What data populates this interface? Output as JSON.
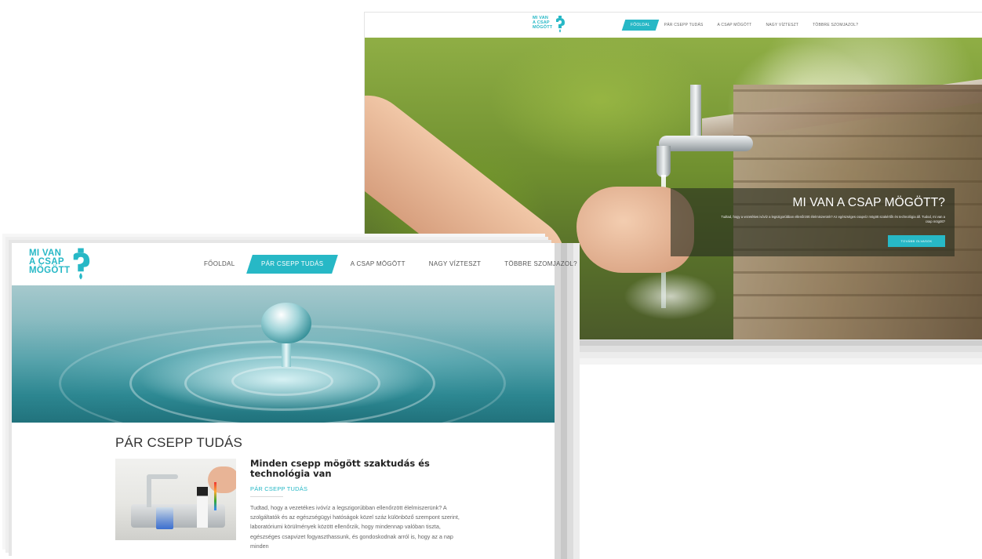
{
  "back_page": {
    "logo": {
      "line1": "MI VAN",
      "line2": "A CSAP",
      "line3": "MÖGÖTT"
    },
    "nav": [
      {
        "label": "FŐOLDAL",
        "active": true
      },
      {
        "label": "PÁR CSEPP TUDÁS",
        "active": false
      },
      {
        "label": "A CSAP MÖGÖTT",
        "active": false
      },
      {
        "label": "NAGY VÍZTESZT",
        "active": false
      },
      {
        "label": "TÖBBRE SZOMJAZOL?",
        "active": false
      }
    ],
    "hero": {
      "title": "MI VAN A CSAP MÖGÖTT?",
      "text": "Tudtad, hogy a vezetékes ivóvíz a legszigorúbban ellenőrzött élelmiszerünk? Az egészséges csapvíz mögött szakértők és technológia áll. Tudod, mi van a csap mögött?",
      "button": "TOVÁBB OLVASOK"
    }
  },
  "front_page": {
    "logo": {
      "line1": "MI VAN",
      "line2": "A CSAP",
      "line3": "MÖGÖTT"
    },
    "nav": [
      {
        "label": "FŐOLDAL",
        "active": false
      },
      {
        "label": "PÁR CSEPP TUDÁS",
        "active": true
      },
      {
        "label": "A CSAP MÖGÖTT",
        "active": false
      },
      {
        "label": "NAGY VÍZTESZT",
        "active": false
      },
      {
        "label": "TÖBBRE SZOMJAZOL?",
        "active": false
      }
    ],
    "section_title": "PÁR CSEPP TUDÁS",
    "post": {
      "title": "Minden csepp mögött szaktudás és technológia van",
      "category": "PÁR CSEPP TUDÁS",
      "excerpt": "Tudtad, hogy a vezetékes ivóvíz a legszigorúbban ellenőrzött élelmiszerünk? A szolgáltatók és az egészségügyi hatóságok közel száz különböző szempont szerint, laboratóriumi körülmények között ellenőrzik, hogy mindennap valóban tiszta, egészséges csapvizet fogyaszthassunk, és gondoskodnak arról is, hogy az a nap minden"
    }
  },
  "colors": {
    "accent": "#27b8c6",
    "text": "#333333",
    "muted": "#666666"
  },
  "icons": {
    "logo": "faucet-drop-icon"
  }
}
